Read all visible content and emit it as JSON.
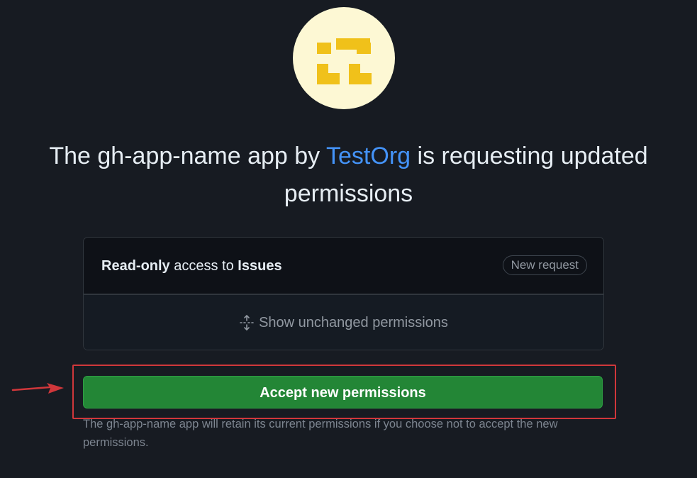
{
  "header": {
    "title_prefix": "The gh-app-name app by",
    "org_name": "TestOrg",
    "title_suffix": "is requesting updated permissions"
  },
  "permissions": {
    "items": [
      {
        "level": "Read-only",
        "connector": "access to",
        "resource": "Issues",
        "badge": "New request"
      }
    ],
    "show_unchanged_label": "Show unchanged permissions"
  },
  "actions": {
    "accept_label": "Accept new permissions",
    "accept_color": "#238636"
  },
  "footer": {
    "note": "The gh-app-name app will retain its current permissions if you choose not to accept the new permissions."
  },
  "icons": {
    "avatar": "app-identicon",
    "unfold": "unfold-icon",
    "annotation": "red-arrow-icon"
  },
  "colors": {
    "background": "#171b22",
    "link": "#4493f8",
    "identicon": "#f0c11a",
    "avatar_bg": "#fdf8d4",
    "annotation": "#d0373b"
  }
}
